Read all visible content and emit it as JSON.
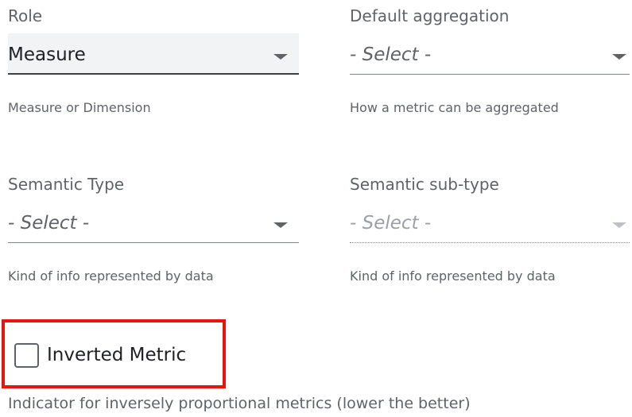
{
  "fields": {
    "role": {
      "label": "Role",
      "value": "Measure",
      "helper": "Measure or Dimension"
    },
    "default_aggregation": {
      "label": "Default aggregation",
      "placeholder": "- Select -",
      "helper": "How a metric can be aggregated"
    },
    "semantic_type": {
      "label": "Semantic Type",
      "placeholder": "- Select -",
      "helper": "Kind of info represented by data"
    },
    "semantic_subtype": {
      "label": "Semantic sub-type",
      "placeholder": "- Select -",
      "helper": "Kind of info represented by data",
      "disabled": true
    }
  },
  "inverted_metric": {
    "label": "Inverted Metric",
    "checked": false,
    "helper": "Indicator for inversely proportional metrics (lower the better)"
  },
  "colors": {
    "highlight": "#e8140f",
    "selected_fill": "#f1f3f4"
  }
}
